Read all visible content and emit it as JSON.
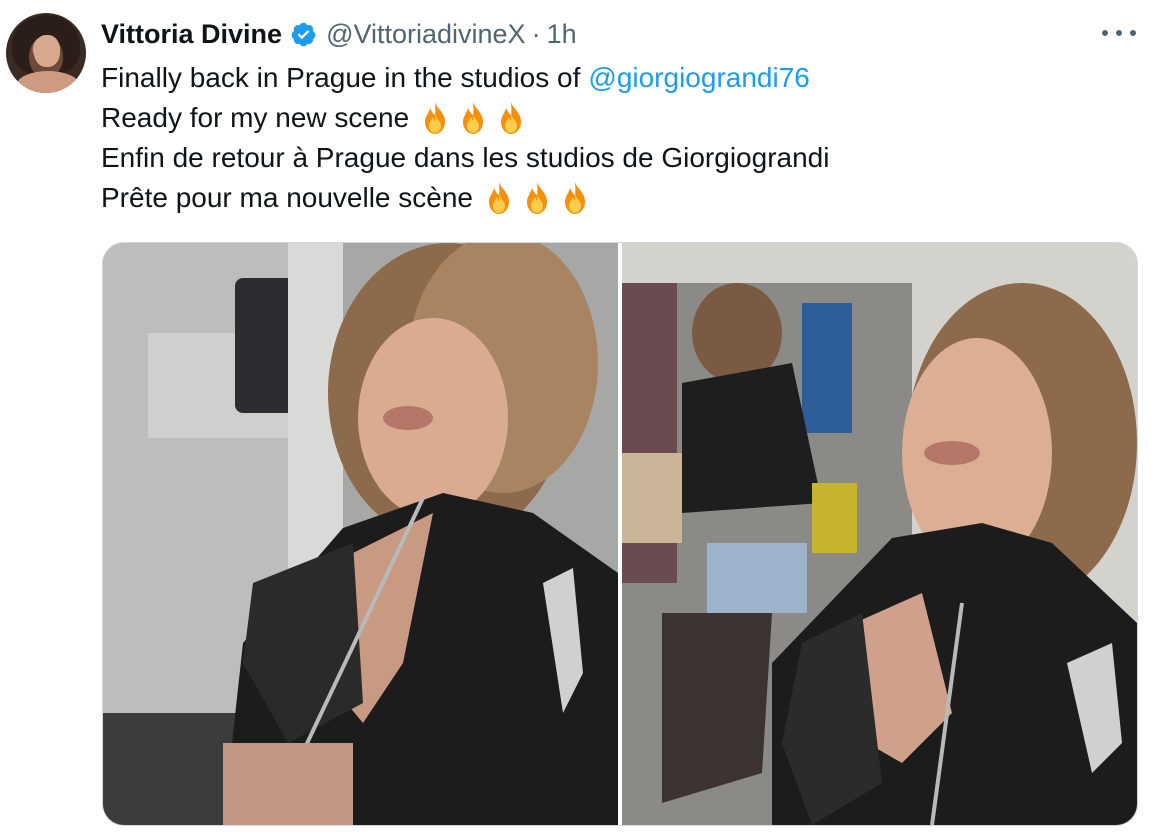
{
  "author": {
    "name": "Vittoria Divine",
    "handle": "@VittoriadivineX",
    "separator": "·",
    "time": "1h",
    "verified": true
  },
  "tweet": {
    "line1_text": "Finally back in Prague in the studios of",
    "line1_mention": "@giorgiograndi76",
    "line2_text": "Ready for my new scene",
    "line3_text": "Enfin de retour à Prague dans les studios de Giorgiograndi",
    "line4_text": "Prête pour ma nouvelle scène"
  },
  "icons": {
    "verified": "verified-badge-icon",
    "more": "more-options-icon",
    "fire": "fire-emoji-icon"
  },
  "colors": {
    "link": "#1d9bf0",
    "verified_badge": "#1d9bf0",
    "secondary_text": "#536471",
    "primary_text": "#0f1419",
    "border": "#cfd9de"
  },
  "media": {
    "images": [
      {
        "alt": "photo-1"
      },
      {
        "alt": "photo-2"
      }
    ]
  }
}
